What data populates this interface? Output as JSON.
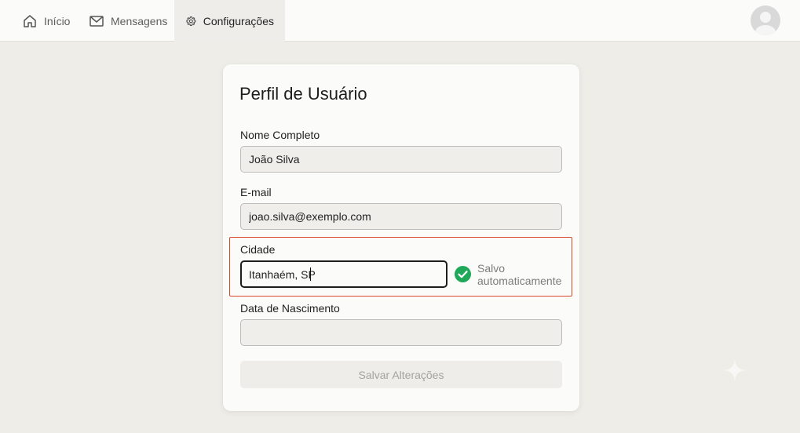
{
  "nav": {
    "items": [
      {
        "label": "Início",
        "icon": "home-icon"
      },
      {
        "label": "Mensagens",
        "icon": "mail-icon"
      },
      {
        "label": "Configurações",
        "icon": "gear-icon",
        "active": true
      }
    ]
  },
  "form": {
    "title": "Perfil de Usuário",
    "name": {
      "label": "Nome Completo",
      "value": "João Silva"
    },
    "email": {
      "label": "E-mail",
      "value": "joao.silva@exemplo.com"
    },
    "city": {
      "label": "Cidade",
      "value": "Itanhaém, SP"
    },
    "birth": {
      "label": "Data de Nascimento",
      "value": ""
    },
    "autosave_status": "Salvo automaticamente",
    "save_label": "Salvar Alterações"
  },
  "colors": {
    "highlight": "#d9462b",
    "success": "#1fa85a",
    "background": "#efede8"
  }
}
